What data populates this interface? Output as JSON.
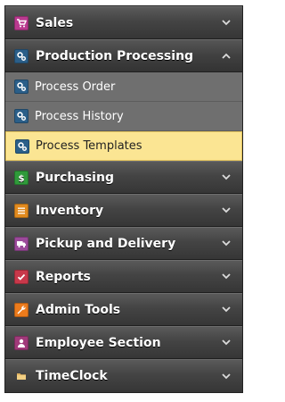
{
  "menu": {
    "sales": {
      "label": "Sales",
      "icon": "cart-icon",
      "color": "#b93a8f"
    },
    "production": {
      "label": "Production Processing",
      "icon": "gears-icon",
      "color": "#2b5f89",
      "items": [
        {
          "label": "Process Order",
          "icon": "gears-icon"
        },
        {
          "label": "Process History",
          "icon": "gears-icon"
        },
        {
          "label": "Process Templates",
          "icon": "gears-icon",
          "active": true
        }
      ]
    },
    "purchasing": {
      "label": "Purchasing",
      "icon": "dollar-icon",
      "color": "#2f9a3a"
    },
    "inventory": {
      "label": "Inventory",
      "icon": "list-icon",
      "color": "#e18a1e"
    },
    "pickup": {
      "label": "Pickup and Delivery",
      "icon": "truck-icon",
      "color": "#9b4a9a"
    },
    "reports": {
      "label": "Reports",
      "icon": "check-icon",
      "color": "#c8384a"
    },
    "admin": {
      "label": "Admin Tools",
      "icon": "wrench-icon",
      "color": "#ec7b1c"
    },
    "employee": {
      "label": "Employee Section",
      "icon": "user-icon",
      "color": "#a03a7a"
    },
    "timeclock": {
      "label": "TimeClock",
      "icon": "folder-icon",
      "color": "#d9a54a"
    }
  },
  "colors": {
    "header_bg": "#444444",
    "submenu_bg": "#6f6f6f",
    "active_bg": "#fbe593"
  }
}
